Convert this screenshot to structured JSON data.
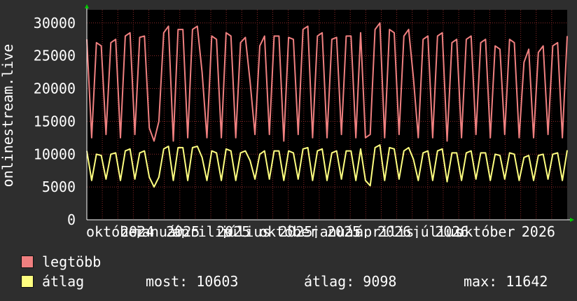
{
  "chart_data": {
    "type": "line",
    "ylabel": "onlinestream.live",
    "ylim": [
      0,
      32000
    ],
    "yticks": [
      0,
      5000,
      10000,
      15000,
      20000,
      25000,
      30000
    ],
    "ytick_labels": [
      "0",
      "5000",
      "10000",
      "15000",
      "20000",
      "25000",
      "30000"
    ],
    "xlim": [
      0,
      100
    ],
    "xtick_labels": [
      {
        "label": "október",
        "pos": 6
      },
      {
        "label": "2024",
        "pos": 10.5
      },
      {
        "label": "január",
        "pos": 15
      },
      {
        "label": "április",
        "pos": 24
      },
      {
        "label": "2025",
        "pos": 20
      },
      {
        "label": "július",
        "pos": 33
      },
      {
        "label": "2025",
        "pos": 30.5
      },
      {
        "label": "október",
        "pos": 42
      },
      {
        "label": "2025",
        "pos": 43.5
      },
      {
        "label": "január",
        "pos": 52
      },
      {
        "label": "2025",
        "pos": 53.5
      },
      {
        "label": "április",
        "pos": 62
      },
      {
        "label": "2026",
        "pos": 64
      },
      {
        "label": "július",
        "pos": 73
      },
      {
        "label": "2026",
        "pos": 76
      },
      {
        "label": "október",
        "pos": 83
      },
      {
        "label": "2026",
        "pos": 94
      }
    ],
    "grid": true,
    "background": "#000000",
    "grid_color": "#8a2a2a",
    "series": [
      {
        "name": "legtöbb",
        "color": "#f08080",
        "x": [
          0,
          1,
          2,
          3,
          4,
          5,
          6,
          7,
          8,
          9,
          10,
          11,
          12,
          13,
          14,
          15,
          16,
          17,
          18,
          19,
          20,
          21,
          22,
          23,
          24,
          25,
          26,
          27,
          28,
          29,
          30,
          31,
          32,
          33,
          34,
          35,
          36,
          37,
          38,
          39,
          40,
          41,
          42,
          43,
          44,
          45,
          46,
          47,
          48,
          49,
          50,
          51,
          52,
          53,
          54,
          55,
          56,
          57,
          58,
          59,
          60,
          61,
          62,
          63,
          64,
          65,
          66,
          67,
          68,
          69,
          70,
          71,
          72,
          73,
          74,
          75,
          76,
          77,
          78,
          79,
          80,
          81,
          82,
          83,
          84,
          85,
          86,
          87,
          88,
          89,
          90,
          91,
          92,
          93,
          94,
          95,
          96,
          97,
          98,
          99,
          100
        ],
        "values": [
          27500,
          12500,
          27000,
          26500,
          13000,
          27000,
          27500,
          12500,
          28000,
          28500,
          13000,
          27800,
          28000,
          14000,
          12000,
          15000,
          28500,
          29500,
          12000,
          29000,
          29000,
          12500,
          29000,
          29500,
          22500,
          12500,
          28000,
          27500,
          12500,
          28500,
          28000,
          12500,
          27000,
          27800,
          21000,
          13000,
          26500,
          28000,
          13000,
          28000,
          28000,
          12000,
          27800,
          27500,
          13000,
          29000,
          29500,
          12500,
          28000,
          28500,
          12500,
          27500,
          27800,
          13000,
          28000,
          28000,
          12500,
          28500,
          12500,
          13000,
          29000,
          30000,
          12500,
          29000,
          28500,
          13000,
          28000,
          29000,
          21500,
          12500,
          27500,
          28000,
          12500,
          28000,
          28500,
          12000,
          27000,
          27500,
          12500,
          27500,
          28000,
          13000,
          27000,
          27500,
          12500,
          26500,
          26000,
          13000,
          27500,
          27000,
          12500,
          24000,
          26000,
          12500,
          25500,
          26500,
          13000,
          26500,
          27000,
          12500,
          28000
        ]
      },
      {
        "name": "átlag",
        "color": "#ffff80",
        "x": [
          0,
          1,
          2,
          3,
          4,
          5,
          6,
          7,
          8,
          9,
          10,
          11,
          12,
          13,
          14,
          15,
          16,
          17,
          18,
          19,
          20,
          21,
          22,
          23,
          24,
          25,
          26,
          27,
          28,
          29,
          30,
          31,
          32,
          33,
          34,
          35,
          36,
          37,
          38,
          39,
          40,
          41,
          42,
          43,
          44,
          45,
          46,
          47,
          48,
          49,
          50,
          51,
          52,
          53,
          54,
          55,
          56,
          57,
          58,
          59,
          60,
          61,
          62,
          63,
          64,
          65,
          66,
          67,
          68,
          69,
          70,
          71,
          72,
          73,
          74,
          75,
          76,
          77,
          78,
          79,
          80,
          81,
          82,
          83,
          84,
          85,
          86,
          87,
          88,
          89,
          90,
          91,
          92,
          93,
          94,
          95,
          96,
          97,
          98,
          99,
          100
        ],
        "values": [
          10500,
          6000,
          10000,
          9800,
          6200,
          10000,
          10200,
          6000,
          10500,
          10800,
          6200,
          10200,
          10500,
          6500,
          5000,
          6500,
          10800,
          11200,
          6000,
          11000,
          11000,
          6000,
          11000,
          11200,
          9500,
          6000,
          10500,
          10200,
          6000,
          10800,
          10500,
          6000,
          10200,
          10500,
          9000,
          6200,
          10000,
          10500,
          6200,
          10500,
          10500,
          6000,
          10500,
          10200,
          6200,
          10800,
          11000,
          6000,
          10500,
          10800,
          6000,
          10200,
          10500,
          6200,
          10500,
          10500,
          6000,
          10800,
          6000,
          5200,
          11000,
          11400,
          6000,
          11000,
          10800,
          6200,
          10500,
          11000,
          9200,
          6000,
          10200,
          10500,
          6000,
          10500,
          10800,
          5800,
          10200,
          10200,
          6000,
          10200,
          10500,
          6200,
          10200,
          10200,
          6000,
          10000,
          9800,
          6200,
          10200,
          10000,
          6000,
          9500,
          9800,
          6000,
          9800,
          10000,
          6200,
          10000,
          10200,
          6000,
          10600
        ]
      }
    ]
  },
  "legend": [
    {
      "label": "legtöbb",
      "color": "#f08080"
    },
    {
      "label": "átlag",
      "color": "#ffff80"
    }
  ],
  "stats": {
    "most": "most: 10603",
    "atlag": "átlag: 9098",
    "max": "max: 11642"
  }
}
